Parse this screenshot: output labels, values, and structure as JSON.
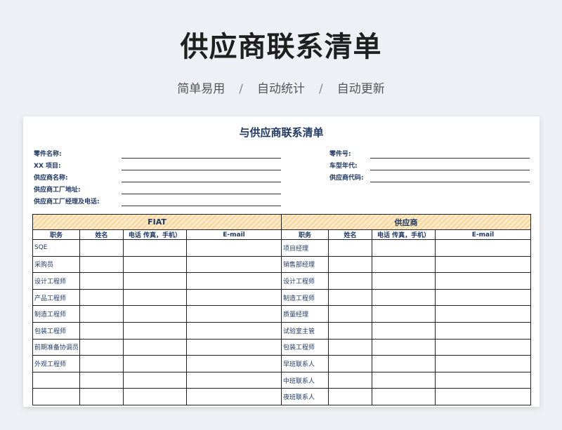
{
  "banner": {
    "title": "供应商联系清单",
    "tags": [
      "简单易用",
      "自动统计",
      "自动更新"
    ],
    "separator": "/"
  },
  "sheet": {
    "title": "与供应商联系清单",
    "left_fields": [
      "零件名称:",
      "XX 项目:",
      "供应商名称:",
      "供应商工厂地址:",
      "供应商工厂经理及电话:"
    ],
    "right_fields": [
      "零件号:",
      "车型年代:",
      "供应商代码:"
    ],
    "table": {
      "group_left": "FIAT",
      "group_right": "供应商",
      "columns": [
        "职务",
        "姓名",
        "电话  传真，手机）",
        "E-mail"
      ],
      "rows": [
        [
          "SQE",
          "项目经理"
        ],
        [
          "采购员",
          "销售部经理"
        ],
        [
          "设计工程师",
          "设计工程师"
        ],
        [
          "产品工程师",
          "制造工程师"
        ],
        [
          "制造工程师",
          "质量经理"
        ],
        [
          "包装工程师",
          "试验室主管"
        ],
        [
          "前期准备协调员",
          "包装工程师"
        ],
        [
          "外观工程师",
          "早班联系人"
        ],
        [
          "",
          "中班联系人"
        ],
        [
          "",
          "夜班联系人"
        ]
      ]
    }
  }
}
